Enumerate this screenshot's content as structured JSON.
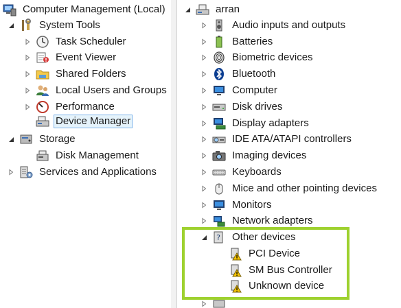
{
  "left_tree": {
    "root": "Computer Management (Local)",
    "system_tools": "System Tools",
    "task_scheduler": "Task Scheduler",
    "event_viewer": "Event Viewer",
    "shared_folders": "Shared Folders",
    "local_users_groups": "Local Users and Groups",
    "performance": "Performance",
    "device_manager": "Device Manager",
    "storage": "Storage",
    "disk_management": "Disk Management",
    "services_apps": "Services and Applications"
  },
  "right_tree": {
    "computer_name": "arran",
    "categories": [
      "Audio inputs and outputs",
      "Batteries",
      "Biometric devices",
      "Bluetooth",
      "Computer",
      "Disk drives",
      "Display adapters",
      "IDE ATA/ATAPI controllers",
      "Imaging devices",
      "Keyboards",
      "Mice and other pointing devices",
      "Monitors",
      "Network adapters"
    ],
    "other_devices": {
      "label": "Other devices",
      "children": [
        "PCI Device",
        "SM Bus Controller",
        "Unknown device"
      ]
    }
  },
  "colors": {
    "highlight_border": "#9ed12f",
    "selection_bg": "#e5f3fb",
    "selection_border": "#7eb4ea"
  }
}
